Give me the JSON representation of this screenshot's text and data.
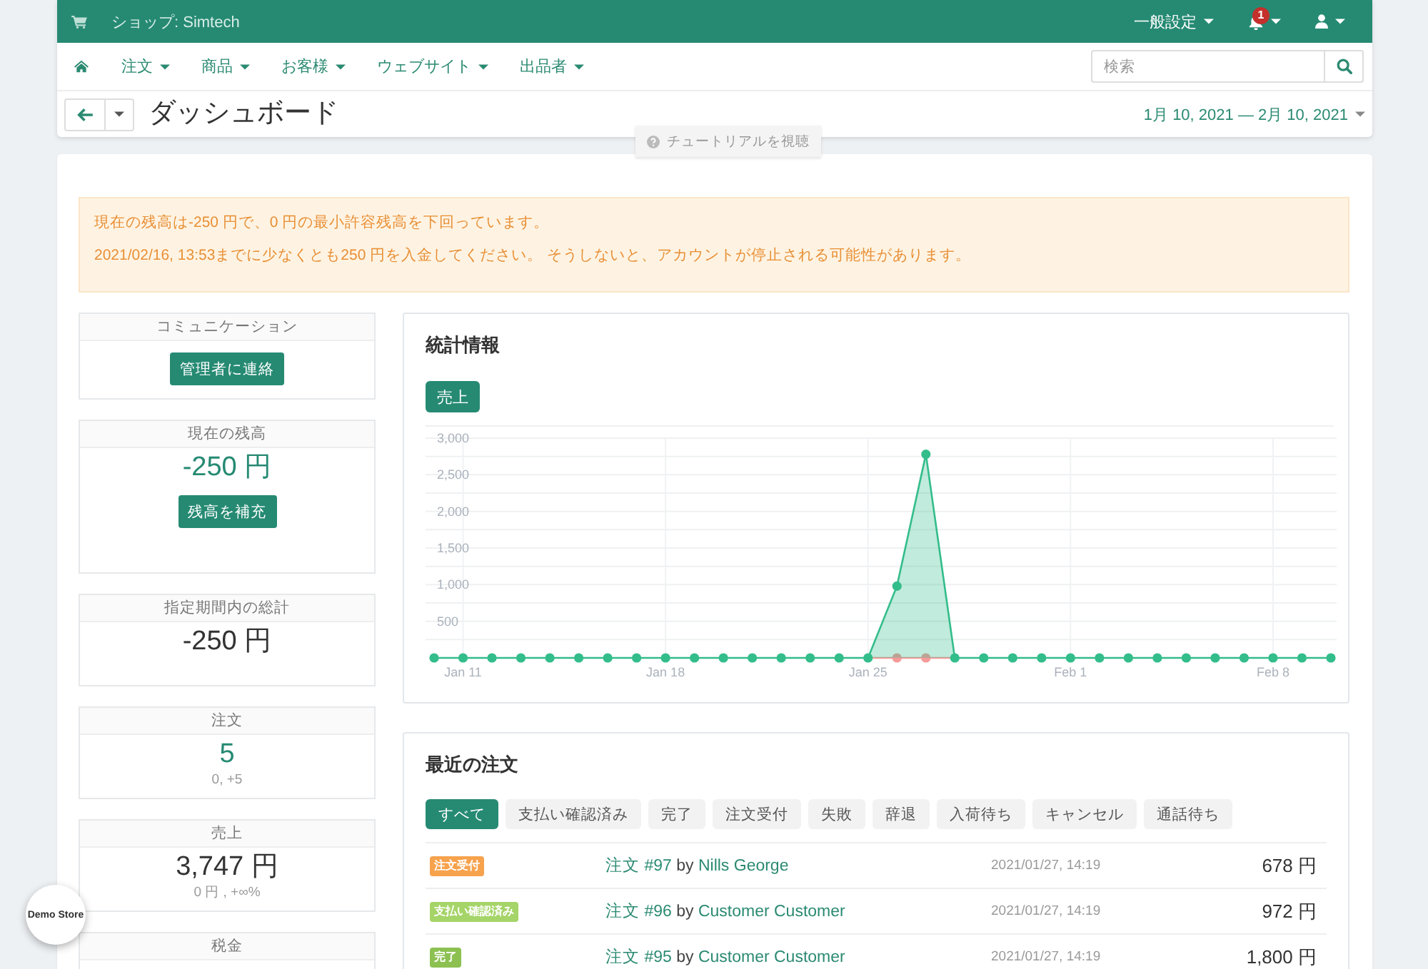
{
  "top_bar": {
    "shop_label": "ショップ: Simtech",
    "settings_menu": "一般設定",
    "notification_count": "1"
  },
  "nav": {
    "menus": [
      "注文",
      "商品",
      "お客様",
      "ウェブサイト",
      "出品者"
    ],
    "search": {
      "placeholder": "検索"
    }
  },
  "title_bar": {
    "title": "ダッシュボード",
    "date_range": "1月 10, 2021 — 2月 10, 2021"
  },
  "tutorial_tab": {
    "label": "チュートリアルを視聴"
  },
  "alert": {
    "lines": [
      "現在の残高は-250 円で、0 円の最小許容残高を下回っています。",
      "2021/02/16, 13:53までに少なくとも250 円を入金してください。 そうしないと、アカウントが停止される可能性があります。"
    ]
  },
  "widgets": [
    {
      "kind": "contact",
      "title": "コミュニケーション",
      "button": "管理者に連絡"
    },
    {
      "kind": "balance",
      "title": "現在の残高",
      "value": "-250 円",
      "highlight": true,
      "button": "残高を補充"
    },
    {
      "kind": "total",
      "title": "指定期間内の総計",
      "value": "-250 円",
      "highlight": false
    },
    {
      "kind": "stat",
      "title": "注文",
      "value": "5",
      "highlight": true,
      "sub": "0, +5"
    },
    {
      "kind": "stat",
      "title": "売上",
      "value": "3,747 円",
      "highlight": false,
      "sub": "0 円 , +∞%"
    },
    {
      "kind": "stat",
      "title": "税金"
    }
  ],
  "statistics": {
    "title": "統計情報",
    "metric_tabs": [
      {
        "label": "売上",
        "selected": true
      }
    ],
    "chart_data": {
      "type": "area",
      "grid": true,
      "categories": [
        null,
        "Jan 11",
        null,
        null,
        null,
        null,
        null,
        null,
        "Jan 18",
        null,
        null,
        null,
        null,
        null,
        null,
        "Jan 25",
        null,
        null,
        null,
        null,
        null,
        null,
        "Feb 1",
        null,
        null,
        null,
        null,
        null,
        null,
        "Feb 8",
        null,
        null
      ],
      "ylim": [
        0,
        3000
      ],
      "yticks": [
        {
          "value": 500,
          "label": "500"
        },
        {
          "value": 1000,
          "label": "1,000"
        },
        {
          "value": 1500,
          "label": "1,500"
        },
        {
          "value": 2000,
          "label": "2,000"
        },
        {
          "value": 2500,
          "label": "2,500"
        },
        {
          "value": 3000,
          "label": "3,000"
        }
      ],
      "series": [
        {
          "color": "#33bd8b",
          "values": [
            0,
            0,
            0,
            0,
            0,
            0,
            0,
            0,
            0,
            0,
            0,
            0,
            0,
            0,
            0,
            0,
            980,
            2780,
            0,
            0,
            0,
            0,
            0,
            0,
            0,
            0,
            0,
            0,
            0,
            0,
            0,
            0
          ]
        },
        {
          "type": "line",
          "color": "#f59a9a",
          "values": [
            null,
            null,
            null,
            null,
            null,
            null,
            null,
            null,
            null,
            null,
            null,
            null,
            null,
            null,
            null,
            0,
            0,
            0,
            0,
            null,
            null,
            null,
            null,
            null,
            null,
            null,
            null,
            null,
            null,
            null,
            null,
            null
          ]
        }
      ]
    }
  },
  "recent_orders": {
    "title": "最近の注文",
    "filters": [
      {
        "label": "すべて",
        "selected": true
      },
      {
        "label": "支払い確認済み",
        "selected": false
      },
      {
        "label": "完了",
        "selected": false
      },
      {
        "label": "注文受付",
        "selected": false
      },
      {
        "label": "失敗",
        "selected": false
      },
      {
        "label": "辞退",
        "selected": false
      },
      {
        "label": "入荷待ち",
        "selected": false
      },
      {
        "label": "キャンセル",
        "selected": false
      },
      {
        "label": "通話待ち",
        "selected": false
      }
    ],
    "rows": [
      {
        "status": "注文受付",
        "color": "#f7a24d",
        "order": "注文 #97",
        "by": "by",
        "customer": "Nills George",
        "date": "2021/01/27, 14:19",
        "amount": "678 円"
      },
      {
        "status": "支払い確認済み",
        "color": "#a5d468",
        "order": "注文 #96",
        "by": "by",
        "customer": "Customer Customer",
        "date": "2021/01/27, 14:19",
        "amount": "972 円"
      },
      {
        "status": "完了",
        "color": "#8cc152",
        "order": "注文 #95",
        "by": "by",
        "customer": "Customer Customer",
        "date": "2021/01/27, 14:19",
        "amount": "1,800 円"
      }
    ]
  },
  "demo_badge": {
    "label": "Demo Store"
  }
}
